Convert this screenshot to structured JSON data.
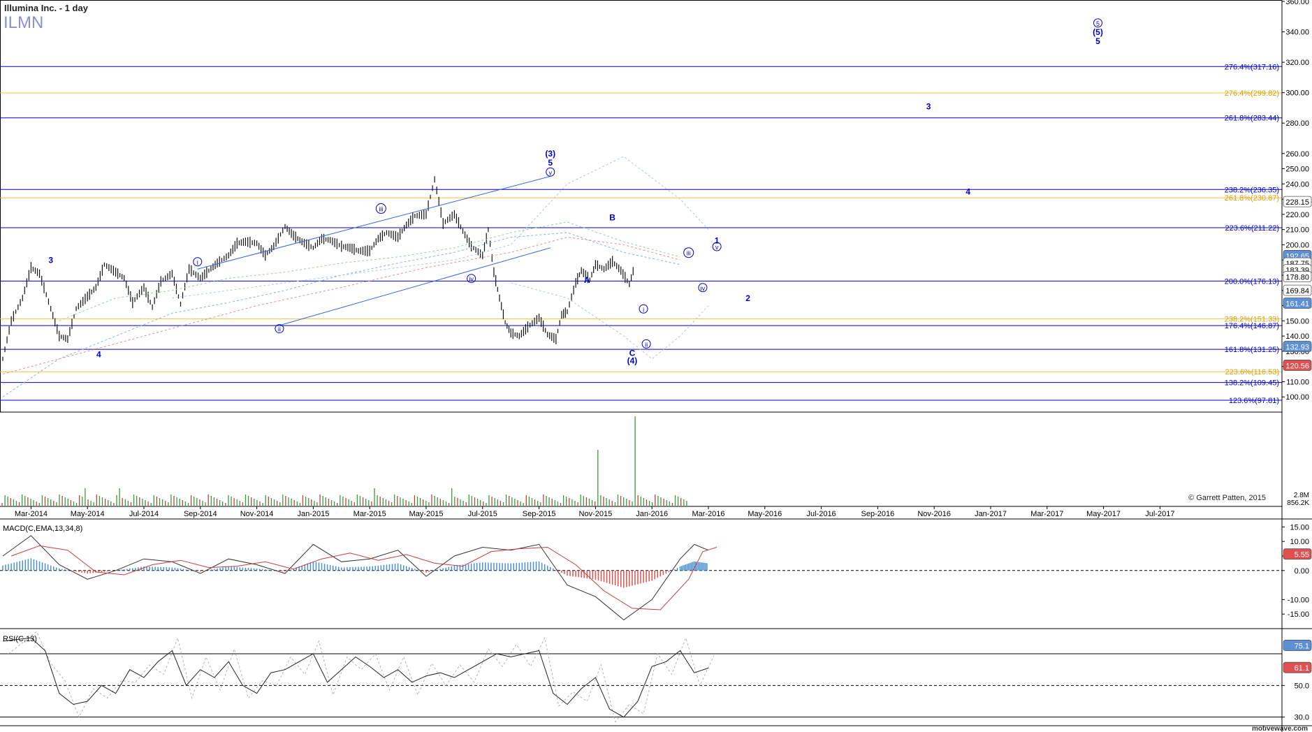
{
  "header": {
    "title": "Illumina Inc. - 1 day",
    "symbol": "ILMN",
    "copyright": "© Garrett Patten, 2015",
    "watermark": "motivewave.com"
  },
  "colors": {
    "blue_line": "#0000cc",
    "gold_line": "#f0c040",
    "wave_label": "#0000cc",
    "price_bar": "#111111"
  },
  "chart_data": [
    {
      "type": "line",
      "panel": "price",
      "title": "Illumina Inc. - 1 day",
      "ylim": [
        90,
        360
      ],
      "y_ticks": [
        "360.00",
        "340.00",
        "320.00",
        "300.00",
        "280.00",
        "260.00",
        "250.00",
        "240.00",
        "230.00",
        "220.00",
        "210.00",
        "200.00",
        "190.00",
        "180.00",
        "170.00",
        "160.00",
        "150.00",
        "140.00",
        "130.00",
        "120.00",
        "110.00",
        "100.00"
      ],
      "x_ticks": [
        "Mar-2014",
        "May-2014",
        "Jul-2014",
        "Sep-2014",
        "Nov-2014",
        "Jan-2015",
        "Mar-2015",
        "May-2015",
        "Jul-2015",
        "Sep-2015",
        "Nov-2015",
        "Jan-2016",
        "Mar-2016",
        "May-2016",
        "Jul-2016",
        "Sep-2016",
        "Nov-2016",
        "Jan-2017",
        "Mar-2017",
        "May-2017",
        "Jul-2017"
      ],
      "x_tick_months": [
        1,
        3,
        5,
        7,
        9,
        11,
        13,
        15,
        17,
        19,
        21,
        23,
        25,
        27,
        29,
        31,
        33,
        35,
        37,
        39,
        41
      ],
      "series": [
        {
          "name": "",
          "x": [
            0,
            0.3,
            0.7,
            1,
            1.3,
            1.7,
            2,
            2.3,
            2.6,
            3,
            3.3,
            3.6,
            4,
            4.3,
            4.6,
            5,
            5.3,
            5.6,
            6,
            6.3,
            6.6,
            7,
            7.3,
            7.6,
            8,
            8.3,
            8.6,
            9,
            9.3,
            9.6,
            10,
            10.3,
            10.6,
            11,
            11.3,
            11.6,
            12,
            12.3,
            12.6,
            13,
            13.3,
            13.6,
            14,
            14.3,
            14.6,
            15,
            15.3,
            15.6,
            16,
            16.3,
            16.6,
            17,
            17.2,
            17.4,
            17.6,
            17.8,
            18,
            18.3,
            18.6,
            19,
            19.3,
            19.6,
            19.8,
            20,
            20.3,
            20.5,
            20.8,
            21,
            21.3,
            21.6,
            21.9,
            22.2,
            22.4
          ],
          "values": [
            125,
            150,
            165,
            185,
            181,
            158,
            140,
            138,
            158,
            166,
            172,
            187,
            182,
            178,
            162,
            172,
            159,
            176,
            181,
            161,
            184,
            178,
            183,
            188,
            193,
            201,
            202,
            201,
            193,
            199,
            212,
            206,
            202,
            198,
            204,
            203,
            199,
            198,
            196,
            196,
            204,
            208,
            205,
            213,
            219,
            220,
            243,
            214,
            220,
            209,
            199,
            193,
            210,
            182,
            165,
            149,
            142,
            140,
            146,
            152,
            141,
            138,
            154,
            156,
            175,
            183,
            177,
            187,
            184,
            189,
            183,
            174,
            187
          ]
        }
      ],
      "volume_ticks": [
        "2.8M",
        "856.2K"
      ],
      "levels": [
        {
          "label": "276.4%(317.16)",
          "value": 317.16,
          "color": "blue"
        },
        {
          "label": "276.4%(299.82)",
          "value": 299.82,
          "color": "gold"
        },
        {
          "label": "261.8%(283.44)",
          "value": 283.44,
          "color": "blue"
        },
        {
          "label": "238.2%(236.35)",
          "value": 236.35,
          "color": "blue"
        },
        {
          "label": "261.8%(230.87)",
          "value": 230.87,
          "color": "gold"
        },
        {
          "label": "223.6%(211.22)",
          "value": 211.22,
          "color": "blue"
        },
        {
          "label": "200.0%(176.13)",
          "value": 176.13,
          "color": "blue"
        },
        {
          "label": "238.2%(151.33)",
          "value": 151.33,
          "color": "gold"
        },
        {
          "label": "176.4%(146.87)",
          "value": 146.87,
          "color": "blue"
        },
        {
          "label": "161.8%(131.25)",
          "value": 131.25,
          "color": "blue"
        },
        {
          "label": "223.6%(116.53)",
          "value": 116.53,
          "color": "gold"
        },
        {
          "label": "138.2%(109.45)",
          "value": 109.45,
          "color": "blue"
        },
        {
          "label": "123.6%(97.81)",
          "value": 97.81,
          "color": "blue"
        }
      ],
      "price_badges": [
        {
          "label": "228.15",
          "value": 228.15,
          "color": "#ffffff"
        },
        {
          "label": "192.65",
          "value": 192.65,
          "color": "#5b8fd6"
        },
        {
          "label": "187.75",
          "value": 187.75,
          "color": "#ffffff"
        },
        {
          "label": "183.39",
          "value": 183.39,
          "color": "#ffffff"
        },
        {
          "label": "178.80",
          "value": 178.8,
          "color": "#ffffff"
        },
        {
          "label": "169.84",
          "value": 169.84,
          "color": "#ffffff"
        },
        {
          "label": "161.41",
          "value": 161.41,
          "color": "#5b8fd6"
        },
        {
          "label": "132.93",
          "value": 132.93,
          "color": "#5b8fd6"
        },
        {
          "label": "120.56",
          "value": 120.56,
          "color": "#e05050"
        }
      ],
      "wave_labels": [
        {
          "text": "3",
          "x": 1.7,
          "y": 188,
          "circled": false
        },
        {
          "text": "4",
          "x": 3.4,
          "y": 126,
          "circled": false
        },
        {
          "text": "i",
          "x": 6.9,
          "y": 187,
          "circled": true
        },
        {
          "text": "ii",
          "x": 9.8,
          "y": 143,
          "circled": true
        },
        {
          "text": "iii",
          "x": 13.4,
          "y": 222,
          "circled": true
        },
        {
          "text": "iv",
          "x": 16.6,
          "y": 176,
          "circled": true
        },
        {
          "text": "(3)",
          "x": 19.4,
          "y": 258,
          "circled": false
        },
        {
          "text": "5",
          "x": 19.4,
          "y": 252,
          "circled": false
        },
        {
          "text": "v",
          "x": 19.4,
          "y": 246,
          "circled": true
        },
        {
          "text": "A",
          "x": 20.7,
          "y": 175,
          "circled": false
        },
        {
          "text": "B",
          "x": 21.6,
          "y": 216,
          "circled": false
        },
        {
          "text": "C",
          "x": 22.3,
          "y": 127,
          "circled": false
        },
        {
          "text": "(4)",
          "x": 22.3,
          "y": 122,
          "circled": false
        },
        {
          "text": "i",
          "x": 22.7,
          "y": 156,
          "circled": true
        },
        {
          "text": "ii",
          "x": 22.8,
          "y": 133,
          "circled": true
        },
        {
          "text": "iii",
          "x": 24.3,
          "y": 193,
          "circled": true
        },
        {
          "text": "iv",
          "x": 24.8,
          "y": 170,
          "circled": true
        },
        {
          "text": "1",
          "x": 25.3,
          "y": 201,
          "circled": false
        },
        {
          "text": "v",
          "x": 25.3,
          "y": 197,
          "circled": true
        },
        {
          "text": "2",
          "x": 26.4,
          "y": 163,
          "circled": false
        },
        {
          "text": "4",
          "x": 34.2,
          "y": 233,
          "circled": false
        },
        {
          "text": "3",
          "x": 32.8,
          "y": 289,
          "circled": false
        },
        {
          "text": "5",
          "x": 38.8,
          "y": 344,
          "circled": true
        },
        {
          "text": "(5)",
          "x": 38.8,
          "y": 338,
          "circled": false
        },
        {
          "text": "5",
          "x": 38.8,
          "y": 332,
          "circled": false
        }
      ]
    },
    {
      "type": "line",
      "panel": "macd",
      "title": "MACD(C,EMA,13,34,8)",
      "ylim": [
        -20,
        17.5
      ],
      "y_ticks": [
        "15.00",
        "10.00",
        "5.00",
        "0.00",
        "-10.00",
        "-15.00"
      ],
      "badge": {
        "label": "5.55",
        "value": 5.55,
        "color": "#e05050"
      },
      "series": [
        {
          "name": "",
          "x": [
            0,
            1,
            2,
            3,
            4,
            5,
            6,
            7,
            8,
            9,
            10,
            11,
            12,
            13,
            14,
            15,
            16,
            17,
            18,
            19,
            20,
            21,
            22,
            23,
            24,
            24.5,
            25
          ],
          "values": [
            5,
            12,
            2,
            -3,
            0,
            4,
            3,
            -1,
            4,
            2,
            -1,
            9,
            3,
            4,
            7,
            -2,
            5,
            8,
            7,
            9,
            -5,
            -9,
            -17,
            -10,
            4,
            9,
            7
          ]
        }
      ]
    },
    {
      "type": "line",
      "panel": "rsi",
      "title": "RSI(C,13)",
      "ylim": [
        25,
        85
      ],
      "y_ticks": [
        "50.0",
        "30.0"
      ],
      "badges": [
        {
          "label": "75.1",
          "value": 75.1,
          "color": "#5b8fd6"
        },
        {
          "label": "61.1",
          "value": 61.1,
          "color": "#e05050"
        }
      ],
      "series": [
        {
          "name": "",
          "x": [
            0,
            1,
            1.5,
            2,
            2.5,
            3,
            3.5,
            4,
            4.5,
            5,
            5.5,
            6,
            6.5,
            7,
            7.5,
            8,
            8.5,
            9,
            9.5,
            10,
            10.5,
            11,
            11.5,
            12,
            12.5,
            13,
            13.5,
            14,
            14.5,
            15,
            15.5,
            16,
            16.5,
            17,
            17.5,
            18,
            18.5,
            19,
            19.5,
            20,
            20.5,
            21,
            21.5,
            22,
            22.5,
            23,
            23.5,
            24,
            24.5,
            25
          ],
          "values": [
            78,
            80,
            72,
            45,
            38,
            40,
            50,
            45,
            60,
            55,
            65,
            72,
            50,
            60,
            55,
            65,
            50,
            45,
            58,
            60,
            65,
            70,
            52,
            60,
            68,
            62,
            55,
            60,
            52,
            56,
            58,
            55,
            60,
            65,
            70,
            68,
            70,
            72,
            45,
            38,
            48,
            55,
            35,
            30,
            40,
            62,
            65,
            72,
            58,
            61
          ]
        }
      ]
    }
  ]
}
